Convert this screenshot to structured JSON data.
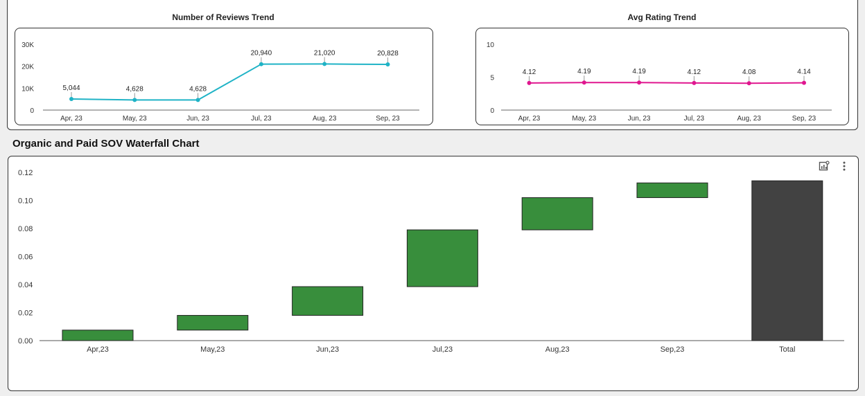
{
  "reviews": {
    "title": "Number of Reviews Trend",
    "chart_data": {
      "type": "line",
      "title": "Number of Reviews Trend",
      "categories": [
        "Apr, 23",
        "May, 23",
        "Jun, 23",
        "Jul, 23",
        "Aug, 23",
        "Sep, 23"
      ],
      "values": [
        5044,
        4628,
        4628,
        20940,
        21020,
        20828
      ],
      "data_labels": [
        "5,044",
        "4,628",
        "4,628",
        "20,940",
        "21,020",
        "20,828"
      ],
      "y_ticks": [
        "0",
        "10K",
        "20K",
        "30K"
      ],
      "ylim": [
        0,
        30000
      ],
      "color": "#1fb3c6"
    }
  },
  "rating": {
    "title": "Avg Rating Trend",
    "chart_data": {
      "type": "line",
      "title": "Avg Rating Trend",
      "categories": [
        "Apr, 23",
        "May, 23",
        "Jun, 23",
        "Jul, 23",
        "Aug, 23",
        "Sep, 23"
      ],
      "values": [
        4.12,
        4.19,
        4.19,
        4.12,
        4.08,
        4.14
      ],
      "data_labels": [
        "4.12",
        "4.19",
        "4.19",
        "4.12",
        "4.08",
        "4.14"
      ],
      "y_ticks": [
        "0",
        "5",
        "10"
      ],
      "ylim": [
        0,
        10
      ],
      "color": "#e0168f"
    }
  },
  "waterfall": {
    "title": "Organic and Paid SOV Waterfall Chart",
    "chart_data": {
      "type": "bar",
      "subtype": "waterfall",
      "categories": [
        "Apr,23",
        "May,23",
        "Jun,23",
        "Jul,23",
        "Aug,23",
        "Sep,23",
        "Total"
      ],
      "values": [
        0.0075,
        0.0105,
        0.0205,
        0.0405,
        0.023,
        0.0105,
        0.114
      ],
      "is_total": [
        false,
        false,
        false,
        false,
        false,
        false,
        true
      ],
      "y_ticks": [
        "0.00",
        "0.02",
        "0.04",
        "0.06",
        "0.08",
        "0.10",
        "0.12"
      ],
      "ylim": [
        0,
        0.125
      ],
      "increase_color": "#388e3c",
      "total_color": "#424242"
    },
    "toolbar": {
      "explore_icon": "chart-explore-icon",
      "more_icon": "more-vert-icon"
    }
  }
}
